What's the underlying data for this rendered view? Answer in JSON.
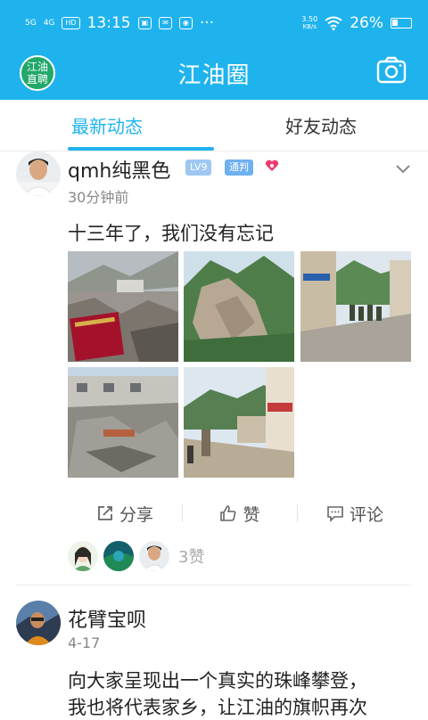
{
  "status": {
    "time": "13:15",
    "net1": "5G",
    "net2": "4G",
    "hd": "HD",
    "more": "···",
    "speed_value": "3.50",
    "speed_unit": "KB/s",
    "battery": "26%"
  },
  "app": {
    "title": "江油圈",
    "brand_line1": "江油",
    "brand_line2": "直聘"
  },
  "tabs": [
    {
      "label": "最新动态"
    },
    {
      "label": "好友动态"
    }
  ],
  "post1": {
    "user": "qmh纯黑色",
    "level": "LV9",
    "role": "通判",
    "time": "30分钟前",
    "text": "十三年了，我们没有忘记",
    "actions": {
      "share": "分享",
      "like": "赞",
      "comment": "评论"
    },
    "likes_count": "3赞"
  },
  "post2": {
    "user": "花臂宝呗",
    "time": "4-17",
    "text_line1": "向大家呈现出一个真实的珠峰攀登，",
    "text_line2": "我也将代表家乡，让江油的旗帜再次"
  },
  "colors": {
    "accent": "#1fb3ee",
    "brand_green": "#22a86a"
  }
}
